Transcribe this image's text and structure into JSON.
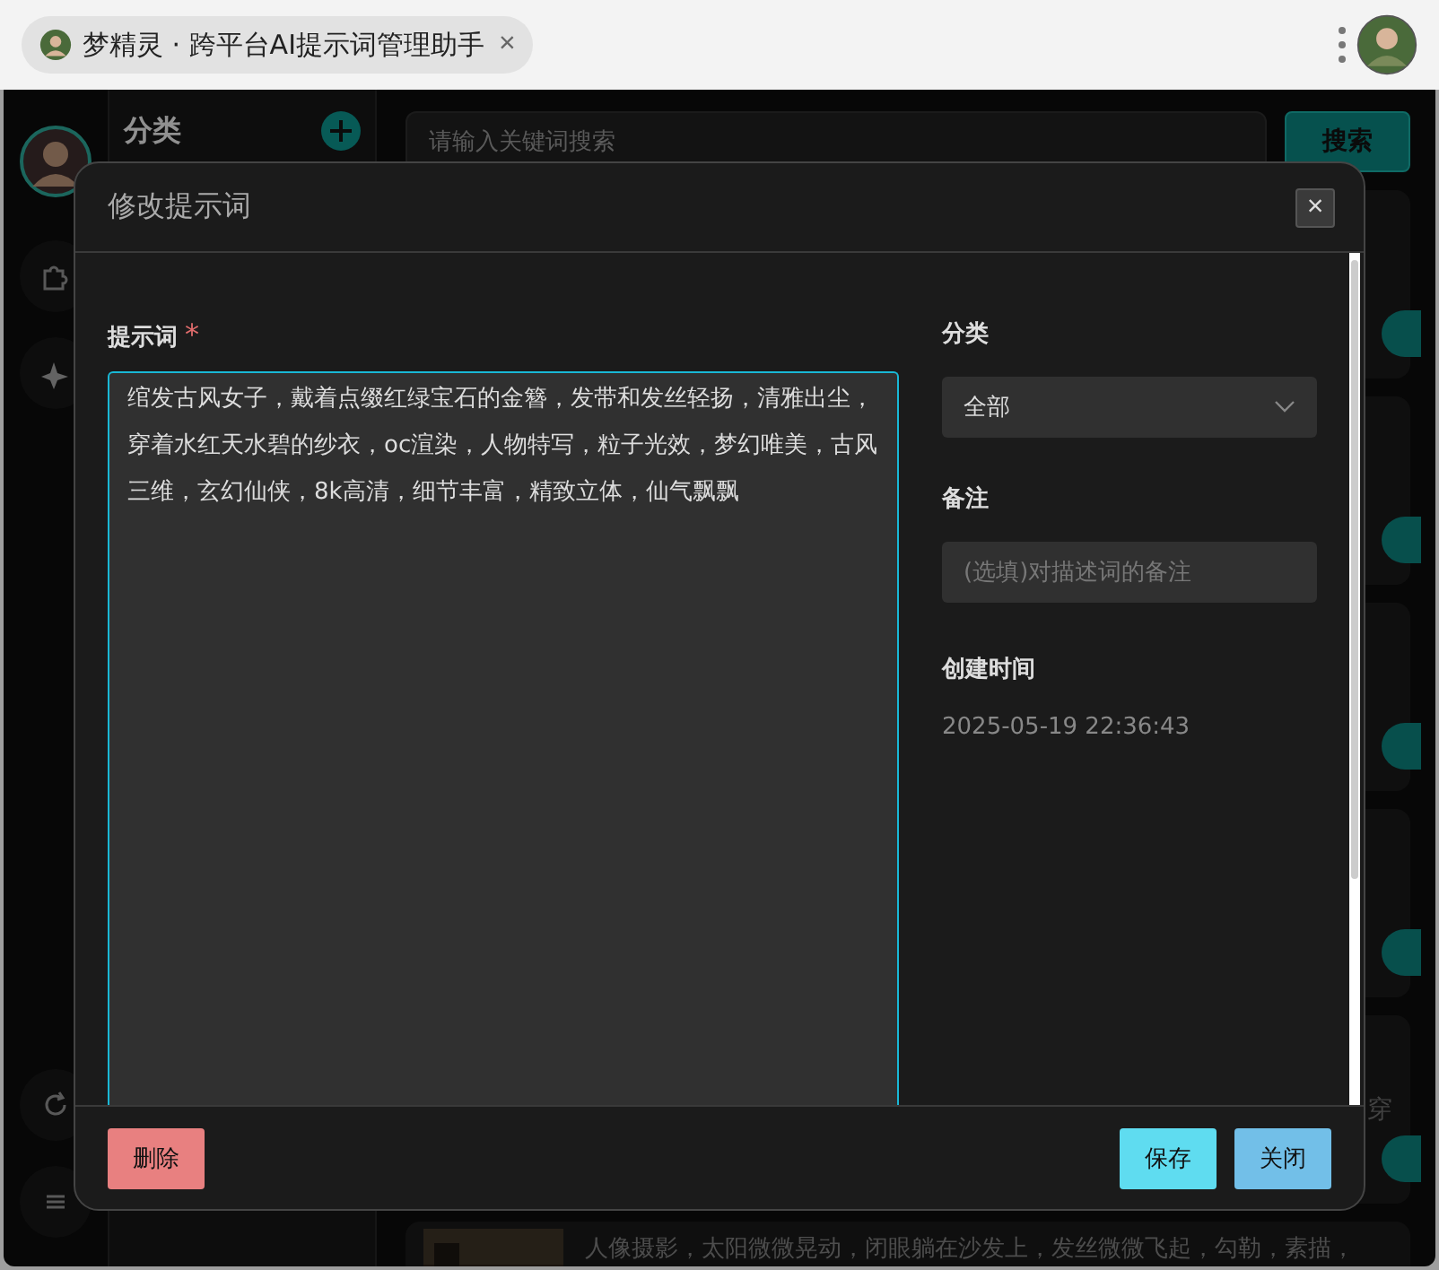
{
  "browser_tab": {
    "title": "梦精灵 · 跨平台AI提示词管理助手",
    "close": "×"
  },
  "sidebar": {
    "title": "分类"
  },
  "search": {
    "placeholder": "请输入关键词搜索",
    "button": "搜索"
  },
  "cards": [
    {
      "kind": "plain"
    },
    {
      "kind": "plain"
    },
    {
      "kind": "plain"
    },
    {
      "kind": "plain"
    },
    {
      "kind": "plain",
      "text": "穿"
    },
    {
      "kind": "picture",
      "text": "人像摄影，太阳微微晃动，闭眼躺在沙发上，发丝微微飞起，勾勒，素描，"
    }
  ],
  "dialog": {
    "title": "修改提示词",
    "close": "×",
    "prompt": {
      "label": "提示词",
      "required_mark": "*",
      "value": "绾发古风女子，戴着点缀红绿宝石的金簪，发带和发丝轻扬，清雅出尘，穿着水红天水碧的纱衣，oc渲染，人物特写，粒子光效，梦幻唯美，古风三维，玄幻仙侠，8k高清，细节丰富，精致立体，仙气飘飘"
    },
    "category": {
      "label": "分类",
      "value": "全部"
    },
    "note": {
      "label": "备注",
      "placeholder": "(选填)对描述词的备注"
    },
    "created": {
      "label": "创建时间",
      "value": "2025-05-19 22:36:43"
    },
    "buttons": [
      {
        "label": "删除",
        "kind": "danger"
      },
      {
        "label": "保存",
        "kind": "primary"
      },
      {
        "label": "关闭",
        "kind": "secondary"
      }
    ]
  }
}
